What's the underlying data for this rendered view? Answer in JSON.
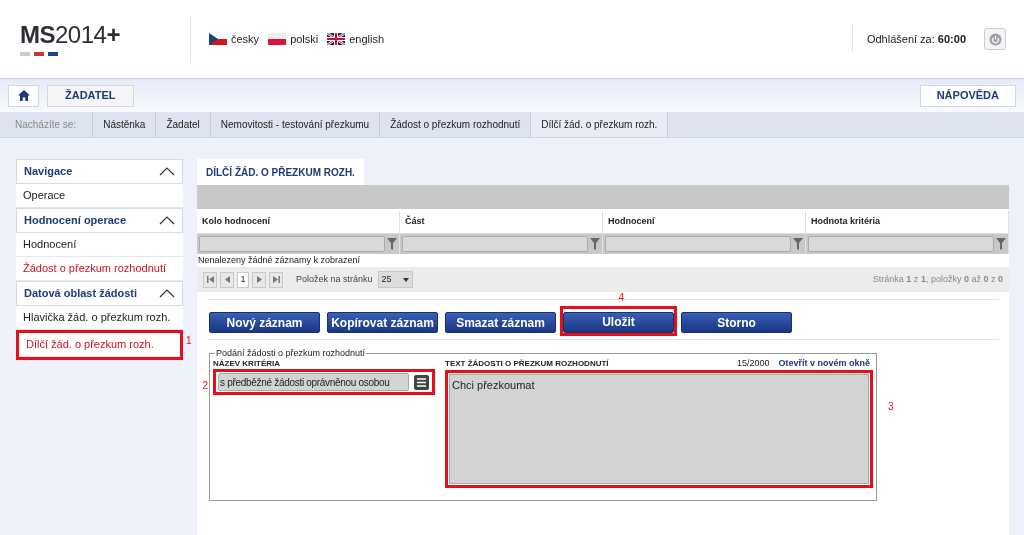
{
  "header": {
    "logo": "**MS**2014**+**",
    "languages": [
      {
        "label": "česky",
        "kind": "cz"
      },
      {
        "label": "polski",
        "kind": "pl"
      },
      {
        "label": "english",
        "kind": "gb"
      }
    ],
    "logout_label": "Odhlášení za:",
    "logout_time": "60:00"
  },
  "toolbar": {
    "user_button": "ŽADATEL",
    "help_button": "NÁPOVĚDA"
  },
  "breadcrumb": {
    "label": "Nacházíte se:",
    "items": [
      "Nástěnka",
      "Žadatel",
      "Nemovitosti - testování přezkumu",
      "Žádost o přezkum rozhodnutí",
      "Dílčí žád. o přezkum rozh."
    ]
  },
  "sidebar": {
    "sections": [
      {
        "title": "Navigace",
        "expanded": true,
        "items": [
          {
            "label": "Operace",
            "highlighted": false
          }
        ]
      },
      {
        "title": "Hodnocení operace",
        "expanded": true,
        "items": [
          {
            "label": "Hodnocení",
            "highlighted": false
          },
          {
            "label": "Žádost o přezkum rozhodnutí",
            "highlighted": true
          }
        ]
      },
      {
        "title": "Datová oblast žádosti",
        "expanded": true,
        "items": [
          {
            "label": "Hlavička žád. o přezkum rozh.",
            "highlighted": false
          },
          {
            "label": "Dílčí žád. o přezkum rozh.",
            "highlighted": true,
            "callout": "1"
          }
        ]
      }
    ]
  },
  "tab": "DÍLČÍ ŽÁD. O PŘEZKUM ROZH.",
  "table": {
    "columns": [
      "Kolo hodnocení",
      "Část",
      "Hodnocení",
      "Hodnota kritéria"
    ],
    "empty_message": "Nenalezeny žádné záznamy k zobrazení"
  },
  "pager": {
    "page": "1",
    "per_page_label": "Položek na stránku",
    "per_page": "25",
    "summary": "Stránka **1** z **1**, položky **0** až **0** z **0**"
  },
  "buttons": [
    {
      "label": "Nový záznam"
    },
    {
      "label": "Kopírovat záznam"
    },
    {
      "label": "Smazat záznam"
    },
    {
      "label": "Uložit",
      "callout": "4"
    },
    {
      "label": "Storno"
    }
  ],
  "form": {
    "legend": "Podání žádosti o přezkum rozhodnutí",
    "criterion": {
      "label": "NÁZEV KRITÉRIA",
      "value": "s předběžné žádosti oprávněnou osobou",
      "callout": "2"
    },
    "request_text": {
      "label": "TEXT ŽÁDOSTI O PŘEZKUM ROZHODNUTÍ",
      "counter": "15/2000",
      "open_link": "Otevřít v novém okně",
      "value": "Chci přezkoumat",
      "callout": "3"
    }
  }
}
